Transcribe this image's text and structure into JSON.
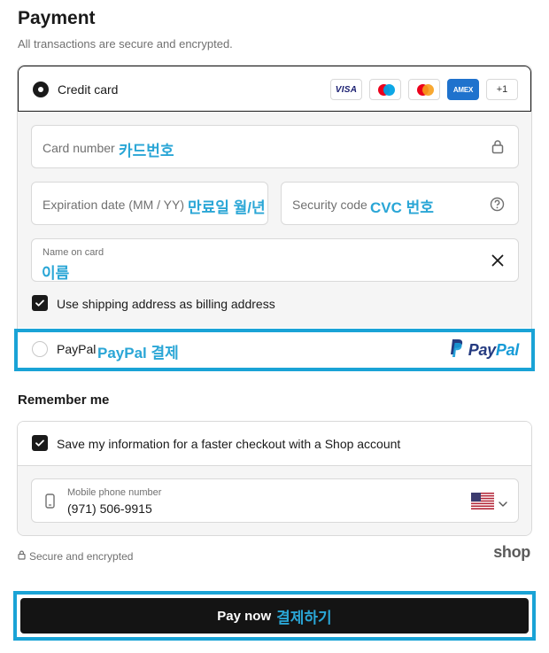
{
  "header": {
    "title": "Payment",
    "subtitle": "All transactions are secure and encrypted."
  },
  "credit_card": {
    "label": "Credit card",
    "brands": [
      "VISA",
      "Maestro",
      "Mastercard",
      "AMEX"
    ],
    "brand_visa": "VISA",
    "brand_amex": "AMEX",
    "more_brands": "+1",
    "card_number": {
      "placeholder": "Card number",
      "annotation": "카드번호"
    },
    "expiration": {
      "placeholder": "Expiration date (MM / YY)",
      "annotation": "만료일 월/년"
    },
    "security_code": {
      "placeholder": "Security code",
      "annotation": "CVC 번호"
    },
    "name_on_card": {
      "label": "Name on card",
      "value": "이름"
    },
    "billing_checkbox": {
      "label": "Use shipping address as billing address",
      "checked": true
    }
  },
  "paypal": {
    "label": "PayPal",
    "annotation": "PayPal 결제",
    "logo_text_pay": "Pay",
    "logo_text_pal": "Pal"
  },
  "remember_me": {
    "title": "Remember me",
    "save_checkbox": {
      "label": "Save my information for a faster checkout with a Shop account",
      "checked": true
    },
    "phone": {
      "label": "Mobile phone number",
      "value": "(971) 506-9915",
      "country_flag": "us-flag-icon"
    }
  },
  "footer": {
    "secure_text": "Secure and encrypted",
    "shop_logo": "shop"
  },
  "pay_button": {
    "label": "Pay now",
    "annotation": "결제하기"
  },
  "colors": {
    "annotation_blue": "#2aa6d6",
    "highlight_border": "#1aa3d6",
    "button_bg": "#141414",
    "paypal_dark": "#253b80",
    "paypal_light": "#179bd7"
  }
}
